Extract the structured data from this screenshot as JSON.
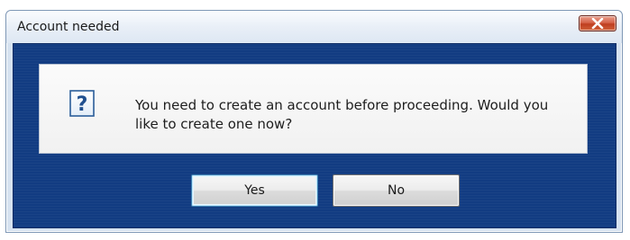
{
  "dialog": {
    "title": "Account needed",
    "message": "You need to create an account before proceeding. Would you like to create one now?",
    "icon": "question-icon",
    "buttons": {
      "yes_label": "Yes",
      "no_label": "No"
    }
  },
  "colors": {
    "client_background": "#123c82",
    "close_button": "#c94a2c",
    "icon_accent": "#1f6fb5"
  }
}
